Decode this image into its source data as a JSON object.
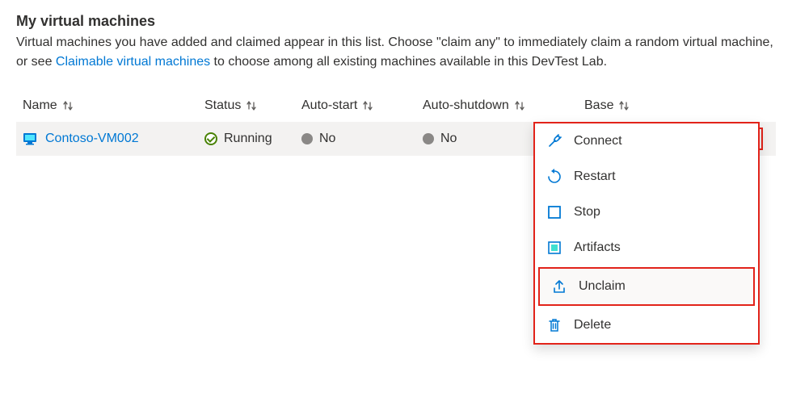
{
  "section": {
    "title": "My virtual machines",
    "desc_before": "Virtual machines you have added and claimed appear in this list. Choose \"claim any\" to immediately claim a random virtual machine, or see ",
    "desc_link": "Claimable virtual machines",
    "desc_after": " to choose among all existing machines available in this DevTest Lab."
  },
  "columns": {
    "name": "Name",
    "status": "Status",
    "autostart": "Auto-start",
    "autoshutdown": "Auto-shutdown",
    "base": "Base"
  },
  "row": {
    "name": "Contoso-VM002",
    "status": "Running",
    "autostart": "No",
    "autoshutdown": "No",
    "base": ""
  },
  "menu": {
    "connect": "Connect",
    "restart": "Restart",
    "stop": "Stop",
    "artifacts": "Artifacts",
    "unclaim": "Unclaim",
    "delete": "Delete"
  }
}
